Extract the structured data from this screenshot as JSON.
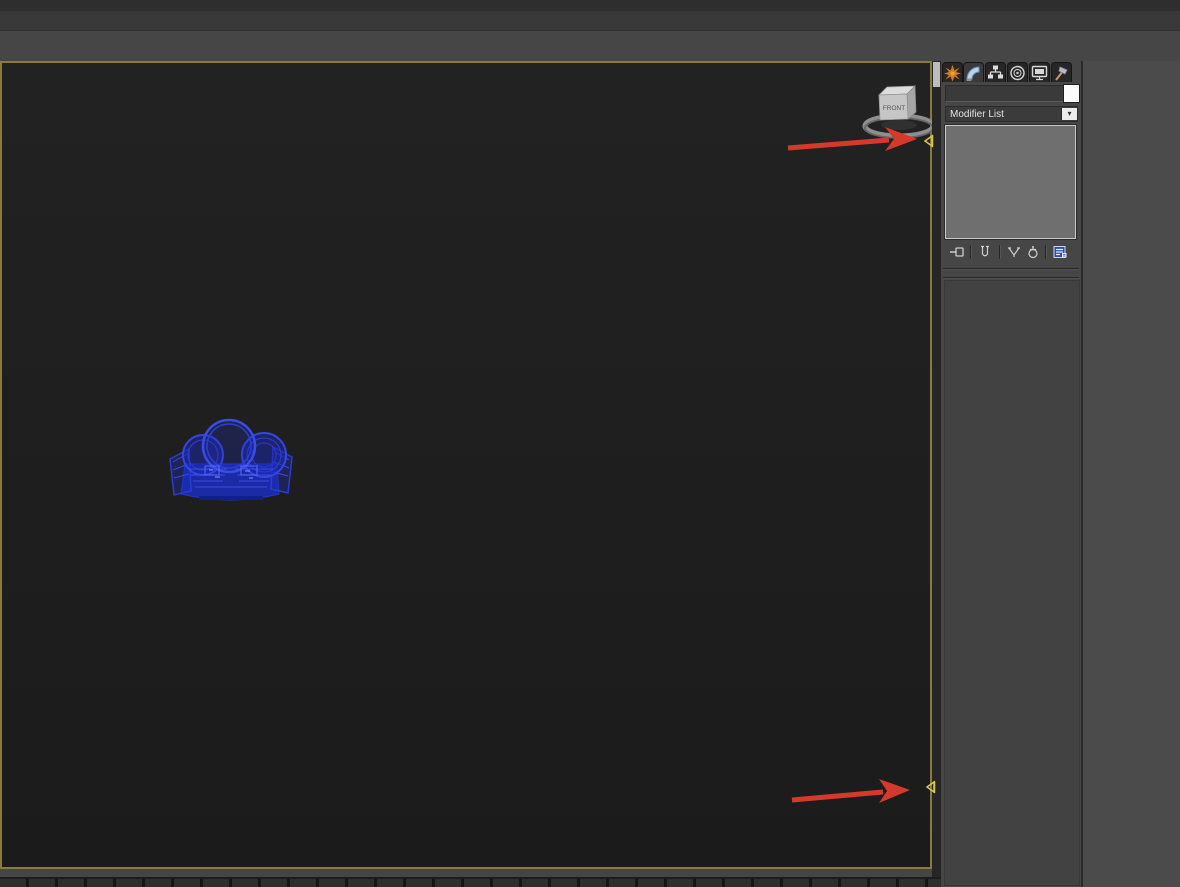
{
  "viewport": {
    "viewcube_label": "FRONT",
    "content": "blue wireframe vehicle model, front orthographic view",
    "edge_markers": [
      {
        "id": "top",
        "shape": "left-pointing-triangle"
      },
      {
        "id": "bottom",
        "shape": "left-pointing-triangle"
      }
    ],
    "annotations": [
      {
        "type": "red-arrow",
        "points_to": "viewport edge marker top"
      },
      {
        "type": "red-arrow",
        "points_to": "viewport edge marker bottom"
      }
    ]
  },
  "command_panel": {
    "tabs": [
      {
        "label": "Create",
        "icon": "create-icon",
        "active": false
      },
      {
        "label": "Modify",
        "icon": "modify-icon",
        "active": true
      },
      {
        "label": "Hierarchy",
        "icon": "hierarchy-icon",
        "active": false
      },
      {
        "label": "Motion",
        "icon": "motion-icon",
        "active": false
      },
      {
        "label": "Display",
        "icon": "display-icon",
        "active": false
      },
      {
        "label": "Utilities",
        "icon": "utilities-icon",
        "active": false
      }
    ],
    "object_name_field": {
      "value": "",
      "placeholder": ""
    },
    "color_swatch": "#fbfbfb",
    "modifier_dropdown": {
      "value": "Modifier List"
    },
    "modifier_stack": {
      "items": []
    },
    "stack_toolbar": [
      {
        "label": "Pin Stack",
        "icon": "pin-stack-icon"
      },
      {
        "label": "Show End Result",
        "icon": "show-end-result-icon"
      },
      {
        "label": "Make Unique",
        "icon": "make-unique-icon"
      },
      {
        "label": "Remove Modifier",
        "icon": "remove-modifier-icon"
      },
      {
        "label": "Configure Modifier Sets",
        "icon": "configure-modifier-sets-icon"
      }
    ]
  },
  "colors": {
    "viewport_background": "#1d1d1d",
    "active_viewport_border": "#877c3e",
    "panel_background": "#464646",
    "annotation_arrow": "#d43a2c",
    "edge_marker": "#d9c84e",
    "model_wireframe_blue": "#2a3bd6"
  }
}
